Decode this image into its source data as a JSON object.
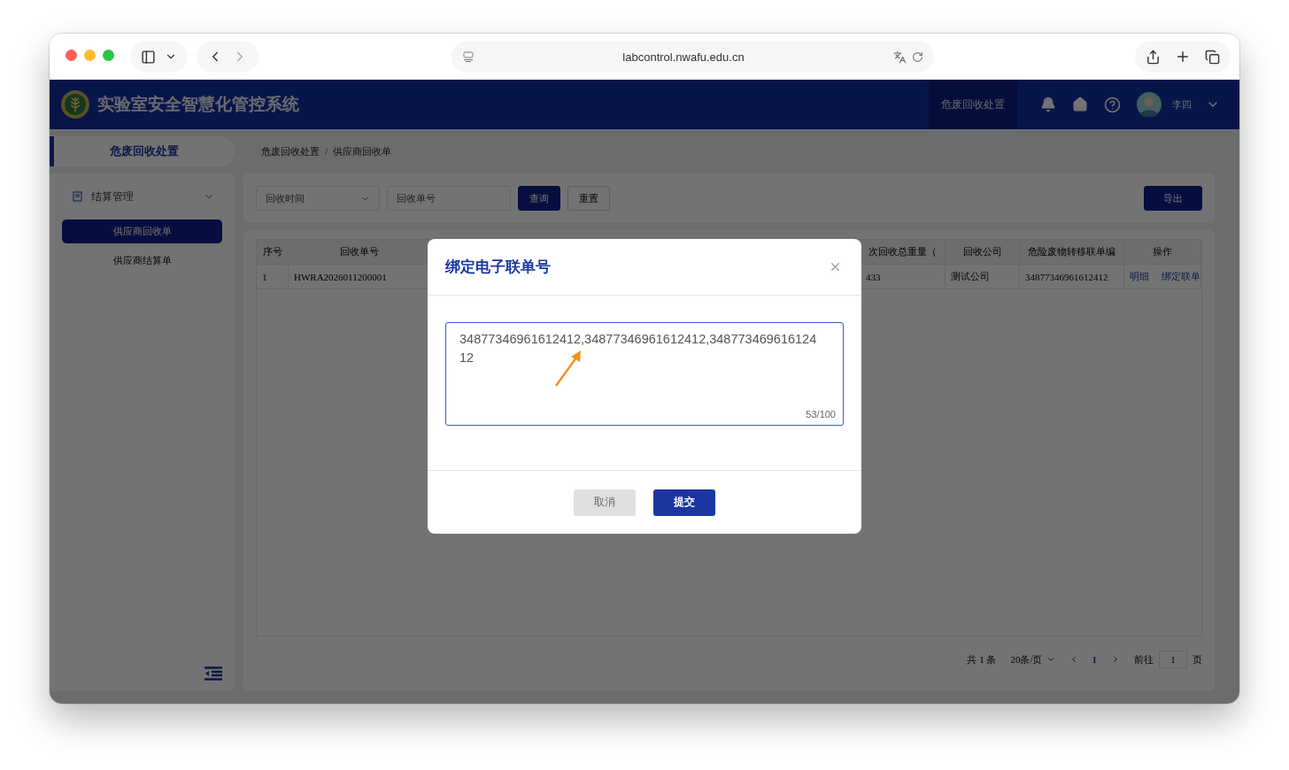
{
  "browser": {
    "url": "labcontrol.nwafu.edu.cn"
  },
  "header": {
    "title": "实验室安全智慧化管控系统",
    "menu": "危废回收处置",
    "user": "李四"
  },
  "sidebar": {
    "section": "危废回收处置",
    "group": {
      "label": "结算管理",
      "expanded": true,
      "items": [
        {
          "label": "供应商回收单",
          "selected": true
        },
        {
          "label": "供应商结算单",
          "selected": false
        }
      ]
    }
  },
  "breadcrumb": {
    "items": [
      "危废回收处置",
      "供应商回收单"
    ],
    "separator": "/"
  },
  "filters": {
    "date_placeholder": "回收时间",
    "number_placeholder": "回收单号",
    "search": "查询",
    "reset": "重置",
    "export": "导出"
  },
  "table": {
    "columns": [
      "序号",
      "回收单号",
      "",
      "次回收总重量（",
      "回收公司",
      "危险废物转移联单编",
      "操作"
    ],
    "rows": [
      {
        "cells": [
          "1",
          "HWRA2026011200001",
          "",
          "433",
          "测试公司",
          "34877346961612412"
        ],
        "actions": [
          "明细",
          "绑定联单"
        ]
      }
    ]
  },
  "pagination": {
    "total": "共 1 条",
    "page_size": "20条/页",
    "pages": [
      {
        "label": "1",
        "selected": true
      }
    ],
    "goto": "前往",
    "goto_value": "1",
    "goto_unit": "页"
  },
  "modal": {
    "title": "绑定电子联单号",
    "value": "34877346961612412,34877346961612412,34877346961612412",
    "counter": "53/100",
    "cancel": "取消",
    "submit": "提交"
  }
}
